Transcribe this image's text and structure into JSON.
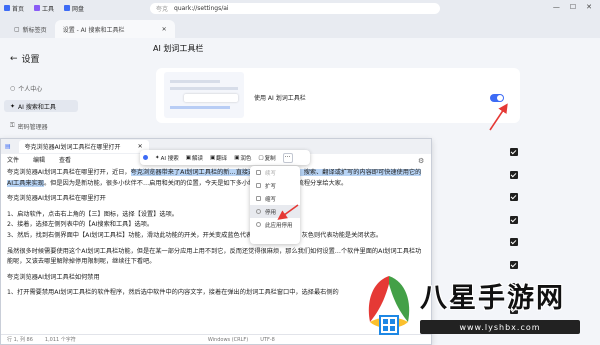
{
  "browser": {
    "bookmarks": [
      {
        "label": "首页",
        "color": "#3d6bf5"
      },
      {
        "label": "工具",
        "color": "#8a5cf6"
      },
      {
        "label": "网盘",
        "color": "#3d6bf5"
      }
    ],
    "address_left": "夸克",
    "address": "quark://settings/ai",
    "tabs": [
      {
        "label": "新标签页"
      },
      {
        "label": "设置 - AI 搜索和工具栏"
      }
    ]
  },
  "sidebar": {
    "title": "设置",
    "items": [
      {
        "label": "个人中心",
        "active": false
      },
      {
        "label": "AI 搜索和工具",
        "active": true
      },
      {
        "label": "密码管理器",
        "active": false
      }
    ]
  },
  "settings": {
    "section_title": "AI 划词工具栏",
    "toggle_label": "使用 AI 划词工具栏",
    "toggle_on": true,
    "accent": "#3d6bf5"
  },
  "notepad": {
    "tab_title": "夸克浏览器AI划词工具栏在哪里打开",
    "menu": [
      "文件",
      "编辑",
      "查看"
    ],
    "paragraphs": [
      {
        "pre": "夸克浏览器AI划词工具栏在哪里打开，近日，",
        "hl": "夸克浏览器带来了AI划词工具栏的新",
        "mid": "…直接选中需要进行润色、搜索、翻译",
        "hl2": "或扩写的内容即可快速使用它的AI工具来实现",
        "post": "。但是因为是新功能，很多小伙伴不…启用和关闭的位置，今天是如下多小编就将具体的步骤流程分享给大家。"
      },
      {
        "text": "夸克浏览器AI划词工具栏在哪里打开"
      },
      {
        "text": "1、启动软件，点击右上角的【三】图标，选择【设置】选项。"
      },
      {
        "text": "2、接着，选择左侧列表中的【AI搜索和工具】选项。"
      },
      {
        "text": "3、然后，找到右侧界面中【AI划词工具栏】功能，滑动此功能的开关，开关变成蓝色代表功能是启用状态，灰色则代表功能是关闭状态。"
      },
      {
        "text": "虽然很多时候需要使用这个AI划词工具栏功能，但是在某一部分应用上用不到它，反而还觉得很麻烦，那么我们如何设置…个软件里面的AI划词工具栏功能呢，又该去哪里解除掉停用限制呢，继续往下看吧。"
      },
      {
        "text": "夸克浏览器AI划词工具栏如何禁用"
      },
      {
        "text": "1、打开需要禁用AI划词工具栏的软件程序，然后选中软件中的内容文字，接着在弹出的划词工具栏窗口中，选择最右侧的"
      }
    ],
    "status": [
      "行 1, 列 86",
      "1,011 个字符",
      "Windows (CRLF)",
      "UTF-8"
    ]
  },
  "toolbar": {
    "items": [
      {
        "label": "AI 搜索",
        "icon": "ai-search-icon"
      },
      {
        "label": "解读",
        "icon": "explain-icon"
      },
      {
        "label": "翻译",
        "icon": "translate-icon"
      },
      {
        "label": "润色",
        "icon": "polish-icon"
      },
      {
        "label": "复制",
        "icon": "copy-icon"
      }
    ],
    "more": "···"
  },
  "popup": {
    "items": [
      {
        "label": "续写",
        "dim": true
      },
      {
        "label": "扩写",
        "dim": false
      },
      {
        "label": "缩写",
        "dim": false
      },
      {
        "label": "停用",
        "dim": false,
        "selected": true
      },
      {
        "label": "此应用停用",
        "dim": false
      }
    ]
  },
  "watermark": {
    "title": "八星手游网",
    "url": "www.lyshbx.com",
    "colors": [
      "#e53935",
      "#fbc02d",
      "#43a047",
      "#1e88e5"
    ]
  },
  "annotation_color": "#e53935"
}
